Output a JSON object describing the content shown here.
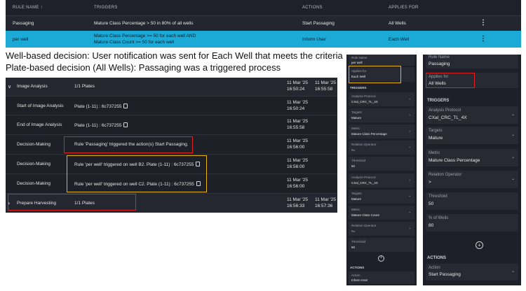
{
  "rules_table": {
    "headers": {
      "rule_name": "RULE NAME",
      "sort_icon": "↑",
      "triggers": "TRIGGERS",
      "actions": "ACTIONS",
      "applies_for": "APPLIES FOR"
    },
    "rows": [
      {
        "name": "Passaging",
        "trigger1": "Mature Class Percentage > 50 in 80% of all wells",
        "trigger2": "",
        "action": "Start Passaging",
        "applies": "All Wells"
      },
      {
        "name": "per well",
        "trigger1": "Mature Class Percentage >= 50 for each well AND",
        "trigger2": "Mature Class Count >= 50 for each well",
        "action": "Inform User",
        "applies": "Each Well"
      }
    ]
  },
  "captions": {
    "line1": "Well-based decision: User notification was sent for Each Well that meets the criteria",
    "line2": "Plate-based decision (All Wells): Passaging was a triggered process"
  },
  "process": {
    "rows": [
      {
        "name": "Image Analysis",
        "detail": "1/1 Plates",
        "d1": "11 Mar '25",
        "t1": "16:50:24",
        "d2": "11 Mar '25",
        "t2": "16:55:58",
        "chevron": "∨"
      },
      {
        "name": "Start of Image Analysis",
        "detail": "Plate (1-11) : 6c737255",
        "d1": "11 Mar '25",
        "t1": "16:50:24",
        "d2": "",
        "t2": ""
      },
      {
        "name": "End of Image Analysis",
        "detail": "Plate (1-11) : 6c737255",
        "d1": "11 Mar '25",
        "t1": "16:55:58",
        "d2": "",
        "t2": ""
      },
      {
        "name": "Decision-Making",
        "detail": "Rule 'Passaging' triggered the action(s) Start Passaging.",
        "d1": "11 Mar '25",
        "t1": "16:56:00",
        "d2": "",
        "t2": ""
      },
      {
        "name": "Decision-Making",
        "detail": "Rule 'per well' triggered on well B2. Plate (1-11) : 6c737255",
        "d1": "11 Mar '25",
        "t1": "16:56:00",
        "d2": "",
        "t2": ""
      },
      {
        "name": "Decision-Making",
        "detail": "Rule 'per well' triggered on well C2. Plate (1-11) : 6c737255",
        "d1": "11 Mar '25",
        "t1": "16:56:00",
        "d2": "",
        "t2": ""
      },
      {
        "name": "Prepare Harvesting",
        "detail": "1/1 Plates",
        "d1": "11 Mar '25",
        "t1": "16:56:33",
        "d2": "11 Mar '25",
        "t2": "16:57:36",
        "chevron": "›"
      }
    ]
  },
  "panel_small": {
    "rule_name_label": "Rule Name",
    "rule_name": "per well",
    "applies_label": "Applies for",
    "applies": "Each Well",
    "triggers": "TRIGGERS",
    "t1": {
      "protocol_label": "Analysis Protocol",
      "protocol": "CXal_CRC_TL_4X",
      "targets_label": "Targets",
      "targets": "Mature",
      "metric_label": "Metric",
      "metric": "Mature Class Percentage",
      "op_label": "Relation Operator",
      "op": ">=",
      "thr_label": "Threshold",
      "thr": "50"
    },
    "t2": {
      "protocol_label": "Analysis Protocol",
      "protocol": "CXal_CRC_TL_4X",
      "targets_label": "Targets",
      "targets": "Mature",
      "metric_label": "Metric",
      "metric": "Mature Class Count",
      "op_label": "Relation Operator",
      "op": ">=",
      "thr_label": "Threshold",
      "thr": "50"
    },
    "actions": "ACTIONS",
    "action_label": "Action",
    "action": "Inform User"
  },
  "panel_large": {
    "rule_name_label": "Rule Name",
    "rule_name": "Passaging",
    "applies_label": "Applies for",
    "applies": "All Wells",
    "triggers": "TRIGGERS",
    "protocol_label": "Analysis Protocol",
    "protocol": "CXal_CRC_TL_4X",
    "targets_label": "Targets",
    "targets": "Mature",
    "metric_label": "Metric",
    "metric": "Mature Class Percentage",
    "op_label": "Relation Operator",
    "op": ">",
    "thr_label": "Threshold",
    "thr": "50",
    "pct_label": "% of Wells",
    "pct": "80",
    "actions": "ACTIONS",
    "action_label": "Action",
    "action": "Start Passaging"
  },
  "icons": {
    "plus": "+",
    "dropdown": "⌄",
    "kebab": "⋮"
  }
}
